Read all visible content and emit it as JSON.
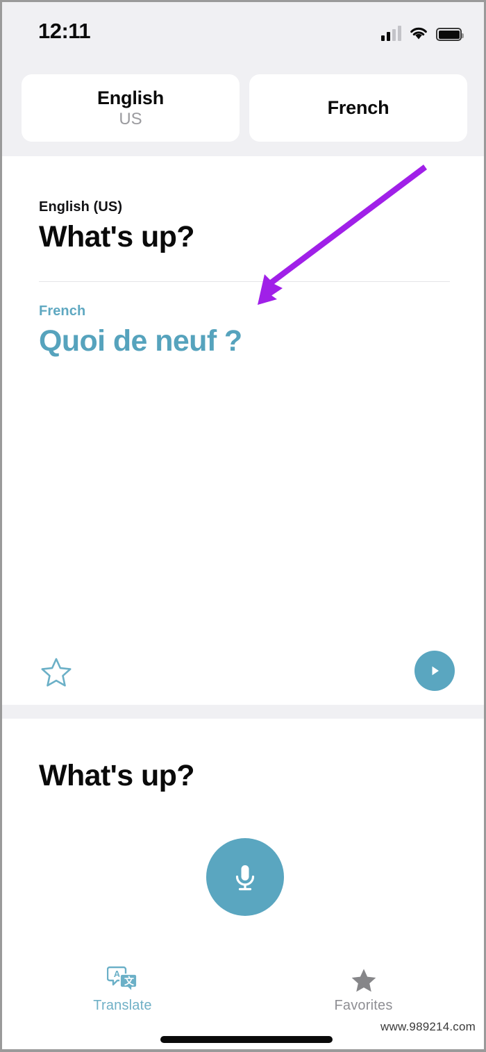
{
  "status_bar": {
    "time": "12:11",
    "signal_icon": "cellular-signal-icon",
    "signal_bars_filled": 2,
    "signal_bars_total": 4,
    "wifi_icon": "wifi-icon",
    "battery_icon": "battery-full-icon"
  },
  "language_selector": {
    "source": {
      "name": "English",
      "region": "US"
    },
    "target": {
      "name": "French",
      "region": ""
    }
  },
  "translation_card": {
    "source_label": "English (US)",
    "source_text": "What's up?",
    "target_label": "French",
    "target_text": "Quoi de neuf ?",
    "favorite_icon": "star-outline-icon",
    "play_icon": "play-icon"
  },
  "input_section": {
    "text": "What's up?",
    "mic_icon": "microphone-icon"
  },
  "tab_bar": {
    "tabs": [
      {
        "label": "Translate",
        "icon": "translate-bubbles-icon",
        "active": true
      },
      {
        "label": "Favorites",
        "icon": "star-filled-icon",
        "active": false
      }
    ]
  },
  "annotation": {
    "type": "arrow",
    "color": "#a020e8"
  },
  "watermark": {
    "text": "www.989214.com"
  },
  "colors": {
    "accent_teal": "#5aa6c0",
    "target_text_teal": "#56a3bd",
    "header_background": "#f0f0f3",
    "card_background": "#ffffff",
    "primary_text": "#0a0a0a",
    "muted_text": "#8e8e93",
    "annotation_purple": "#a020e8"
  }
}
